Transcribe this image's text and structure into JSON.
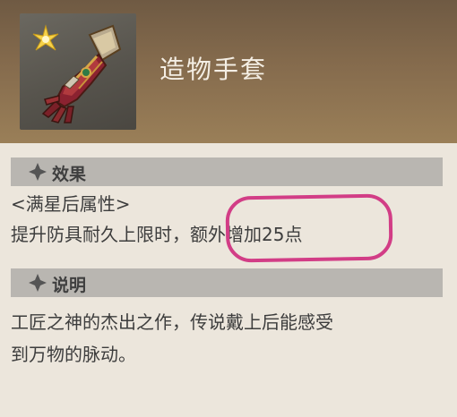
{
  "item": {
    "name": "造物手套",
    "icon": "ornate-gauntlet-icon",
    "star_icon": "gold-star-icon"
  },
  "effect": {
    "title": "效果",
    "condition": "<满星后属性>",
    "description_prefix": "提升防具耐久上限时，",
    "description_highlight": "额外增加25点"
  },
  "description": {
    "title": "说明",
    "line1": "工匠之神的杰出之作，传说戴上后能感受",
    "line2": "到万物的脉动。"
  },
  "colors": {
    "header": "#856b4d",
    "panel": "#ece6dc",
    "section_bar": "#b9b6b1",
    "highlight": "#d23d86"
  }
}
